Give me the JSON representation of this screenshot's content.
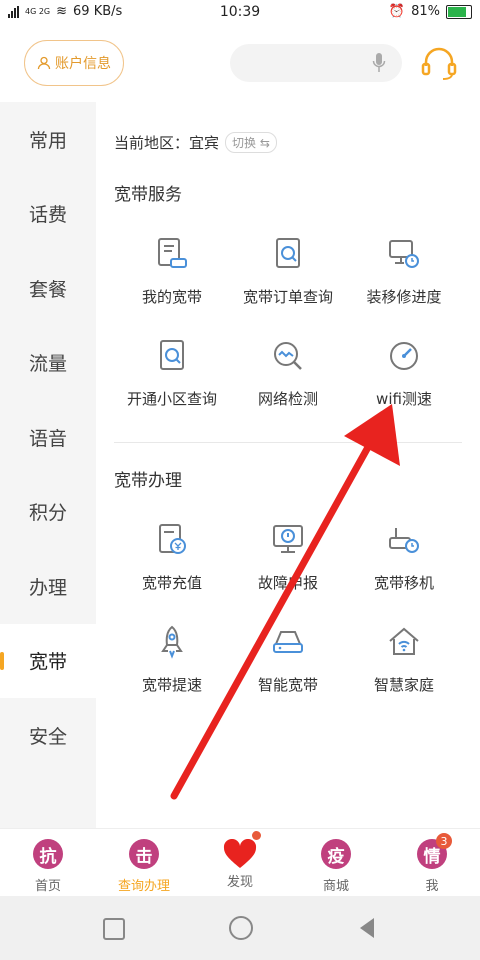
{
  "status": {
    "signal_left": "4G 2G",
    "speed": "69 KB/s",
    "time": "10:39",
    "battery": "81%",
    "battery_level": 0.81
  },
  "header": {
    "account_label": "账户信息"
  },
  "sidebar": {
    "items": [
      {
        "label": "常用"
      },
      {
        "label": "话费"
      },
      {
        "label": "套餐"
      },
      {
        "label": "流量"
      },
      {
        "label": "语音"
      },
      {
        "label": "积分"
      },
      {
        "label": "办理"
      },
      {
        "label": "宽带"
      },
      {
        "label": "安全"
      }
    ],
    "active": "宽带"
  },
  "region": {
    "label": "当前地区：宜宾",
    "switch_label": "切换"
  },
  "sections": [
    {
      "title": "宽带服务",
      "items": [
        {
          "label": "我的宽带",
          "icon": "doc-router-icon"
        },
        {
          "label": "宽带订单查询",
          "icon": "doc-search-icon"
        },
        {
          "label": "装移修进度",
          "icon": "monitor-clock-icon"
        },
        {
          "label": "开通小区查询",
          "icon": "doc-search-icon"
        },
        {
          "label": "网络检测",
          "icon": "magnifier-wave-icon"
        },
        {
          "label": "wifi测速",
          "icon": "speedometer-icon"
        }
      ]
    },
    {
      "title": "宽带办理",
      "items": [
        {
          "label": "宽带充值",
          "icon": "doc-yen-icon"
        },
        {
          "label": "故障申报",
          "icon": "monitor-alert-icon"
        },
        {
          "label": "宽带移机",
          "icon": "router-clock-icon"
        },
        {
          "label": "宽带提速",
          "icon": "rocket-icon"
        },
        {
          "label": "智能宽带",
          "icon": "router-icon"
        },
        {
          "label": "智慧家庭",
          "icon": "home-wifi-icon"
        }
      ]
    }
  ],
  "tabbar": [
    {
      "label": "首页",
      "glyph": "抗"
    },
    {
      "label": "查询办理",
      "glyph": "击",
      "active": true
    },
    {
      "label": "发现",
      "glyph": "heart"
    },
    {
      "label": "商城",
      "glyph": "疫"
    },
    {
      "label": "我",
      "glyph": "情",
      "badge": "3"
    }
  ],
  "colors": {
    "accent": "#f5a623",
    "tab_circle": "#c0407e",
    "arrow": "#e8231f"
  }
}
